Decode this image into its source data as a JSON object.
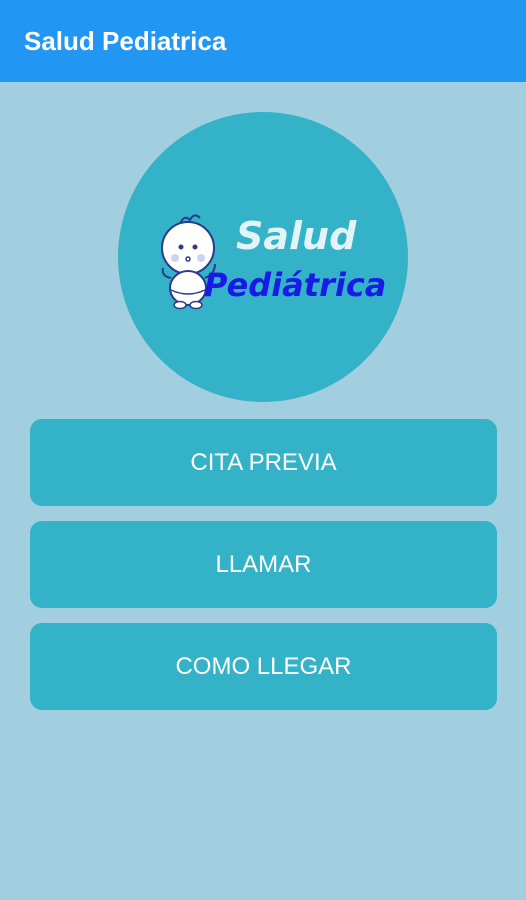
{
  "app_bar": {
    "title": "Salud Pediatrica",
    "background": "#2196f3"
  },
  "logo": {
    "line1": "Salud",
    "line2": "Pediátrica",
    "circle_color": "#33b2c8",
    "line1_color": "#e3f4f8",
    "line2_color": "#1a1ae6",
    "mascot_icon": "baby-mascot-icon"
  },
  "menu": {
    "button_color": "#33b2c8",
    "items": [
      {
        "label": "CITA PREVIA"
      },
      {
        "label": "LLAMAR"
      },
      {
        "label": "COMO LLEGAR"
      }
    ]
  },
  "background": "#a2cfe0"
}
